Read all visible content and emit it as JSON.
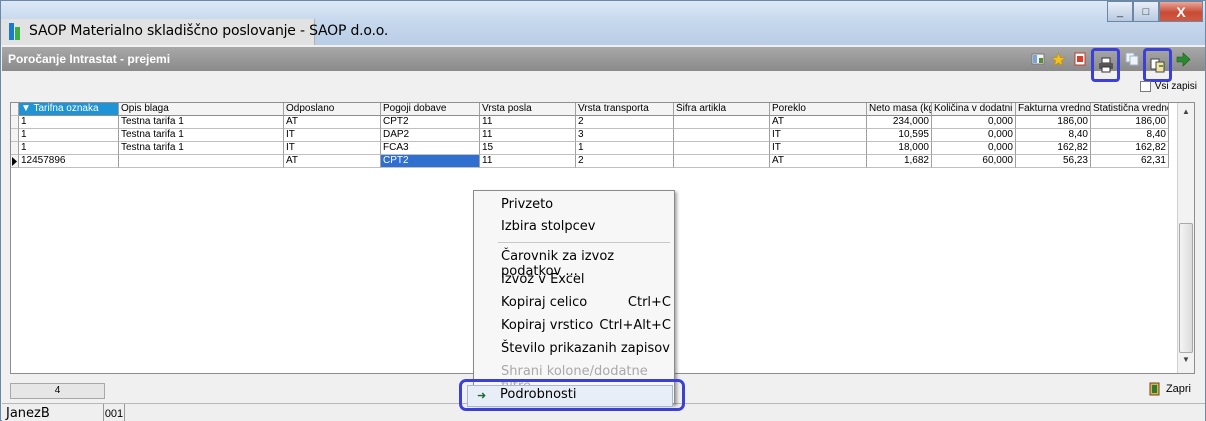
{
  "window": {
    "title": "SAOP Materialno skladiščno poslovanje - SAOP d.o.o.",
    "controls": {
      "minimize": "_",
      "maximize": "□",
      "close": "X"
    }
  },
  "form": {
    "title": "Poročanje Intrastat - prejemi",
    "toolbar_icons": [
      "grid-icon",
      "star-icon",
      "report-icon",
      "print-icon",
      "copy-icon",
      "transfer-icon",
      "exit-arrow-icon"
    ],
    "vsi_zapisi_label": "Vsi zapisi"
  },
  "grid": {
    "columns": [
      "Tarifna oznaka",
      "Opis blaga",
      "Odposlano",
      "Pogoji dobave",
      "Vrsta posla",
      "Vrsta transporta",
      "Šifra artikla",
      "Poreklo",
      "Neto masa (kg)",
      "Količina v dodatni ME",
      "Fakturna vrednost",
      "Statistična vrednost"
    ],
    "rows": [
      [
        "1",
        "Testna tarifa 1",
        "AT",
        "CPT2",
        "11",
        "2",
        "",
        "AT",
        "234,000",
        "0,000",
        "186,00",
        "186,00"
      ],
      [
        "1",
        "Testna tarifa 1",
        "IT",
        "DAP2",
        "11",
        "3",
        "",
        "IT",
        "10,595",
        "0,000",
        "8,40",
        "8,40"
      ],
      [
        "1",
        "Testna tarifa 1",
        "IT",
        "FCA3",
        "15",
        "1",
        "",
        "IT",
        "18,000",
        "0,000",
        "162,82",
        "162,82"
      ],
      [
        "12457896",
        "",
        "AT",
        "CPT2",
        "11",
        "2",
        "",
        "AT",
        "1,682",
        "60,000",
        "56,23",
        "62,31"
      ]
    ],
    "record_count": "4"
  },
  "context_menu": {
    "items": [
      {
        "label": "Privzeto",
        "shortcut": ""
      },
      {
        "label": "Izbira stolpcev",
        "shortcut": ""
      },
      {
        "label": "Čarovnik za izvoz podatkov ...",
        "shortcut": ""
      },
      {
        "label": "Izvoz v Excel",
        "shortcut": ""
      },
      {
        "label": "Kopiraj celico",
        "shortcut": "Ctrl+C"
      },
      {
        "label": "Kopiraj vrstico",
        "shortcut": "Ctrl+Alt+C"
      },
      {
        "label": "Število prikazanih zapisov",
        "shortcut": ""
      },
      {
        "label": "Shrani kolone/dodatne filtre",
        "shortcut": ""
      },
      {
        "label": "Podrobnosti",
        "shortcut": ""
      }
    ]
  },
  "footer": {
    "close_label": "Zapri",
    "user": "JanezB",
    "company_code": "001"
  },
  "colors": {
    "sorted_header": "#1e93d6",
    "selection": "#2f6fd0",
    "highlight_border": "#3b41d6"
  }
}
